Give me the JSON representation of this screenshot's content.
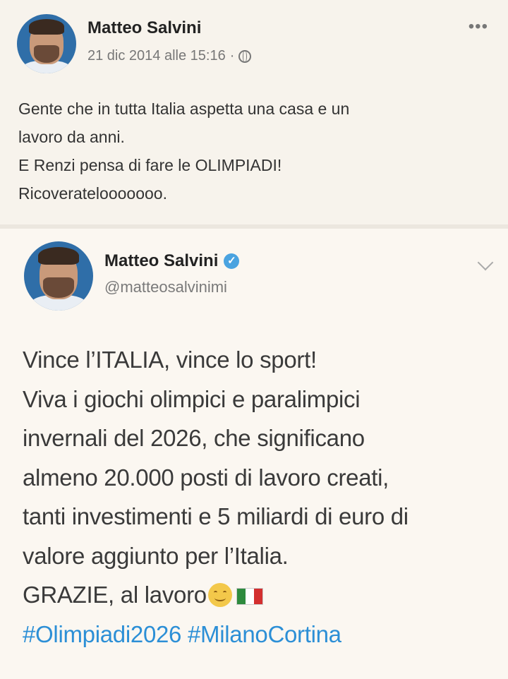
{
  "fb_post": {
    "author": "Matteo Salvini",
    "timestamp": "21 dic 2014 alle 15:16",
    "separator": "·",
    "more": "•••",
    "lines": [
      "Gente che in tutta Italia aspetta una casa e un",
      "lavoro da anni.",
      "E Renzi pensa di fare le OLIMPIADI!",
      "Ricoveratelooooooo."
    ]
  },
  "tweet": {
    "author": "Matteo Salvini",
    "handle": "@matteosalvinimi",
    "verified_glyph": "✓",
    "lines": [
      "Vince l’ITALIA, vince lo sport!",
      "Viva i giochi olimpici e paralimpici",
      "invernali del 2026, che significano",
      "almeno 20.000 posti di lavoro creati,",
      "tanti investimenti e 5 miliardi di euro di",
      "valore aggiunto per l’Italia.",
      "GRAZIE, al lavoro"
    ],
    "hashtags": [
      "#Olimpiadi2026",
      "#MilanoCortina"
    ],
    "emoji": "smiling-face-icon",
    "flag_colors": [
      "#2e8b3e",
      "#ffffff",
      "#d32f2f"
    ]
  },
  "colors": {
    "hashtag": "#2c8fd6",
    "verified": "#4aa3e0"
  }
}
